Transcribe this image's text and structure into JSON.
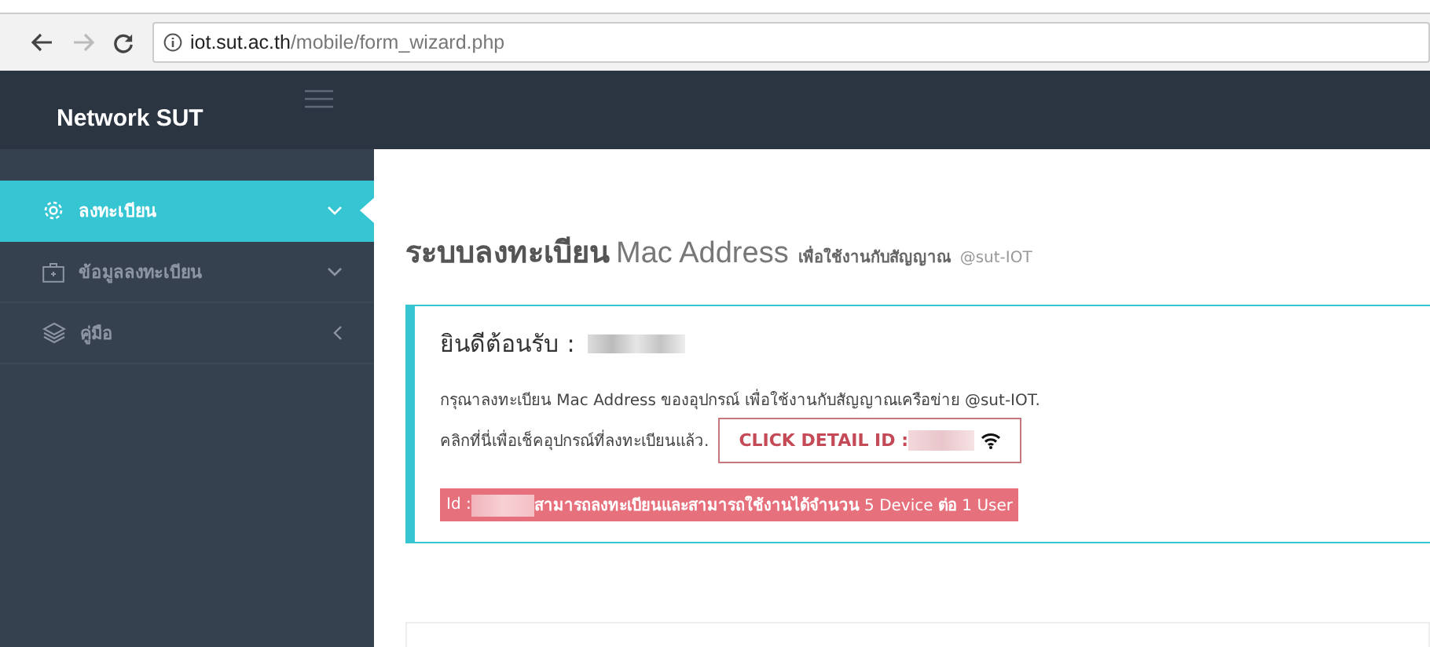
{
  "browser": {
    "url_host": "iot.sut.ac.th",
    "url_path": "/mobile/form_wizard.php"
  },
  "brand": "Network SUT",
  "sidebar": {
    "items": [
      {
        "label": "ลงทะเบียน",
        "expanded": true,
        "selected": true
      },
      {
        "label": "ข้อมูลลงทะเบียน",
        "expanded": true,
        "selected": false
      },
      {
        "label": "คู่มือ",
        "expanded": false,
        "selected": false
      }
    ]
  },
  "page_title": {
    "main": "ระบบลงทะเบียน",
    "sub": "Mac Address",
    "note": "เพื่อใช้งานกับสัญญาณ",
    "tag": "@sut-IOT"
  },
  "card": {
    "welcome": "ยินดีต้อนรับ :",
    "instruction": "กรุณาลงทะเบียน Mac Address ของอุปกรณ์ เพื่อใช้งานกับสัญญาณเครือข่าย @sut-IOT.",
    "check_label": "คลิกที่นี่เพื่อเช็คอุปกรณ์ที่ลงทะเบียนแล้ว.",
    "detail_button": "CLICK DETAIL ID : ",
    "notice": "Id : ",
    "notice_text": "**สามารถลงทะเบียนและสามารถใช้งานได้จำนวน** 5 Device **ต่อ** 1 User"
  }
}
